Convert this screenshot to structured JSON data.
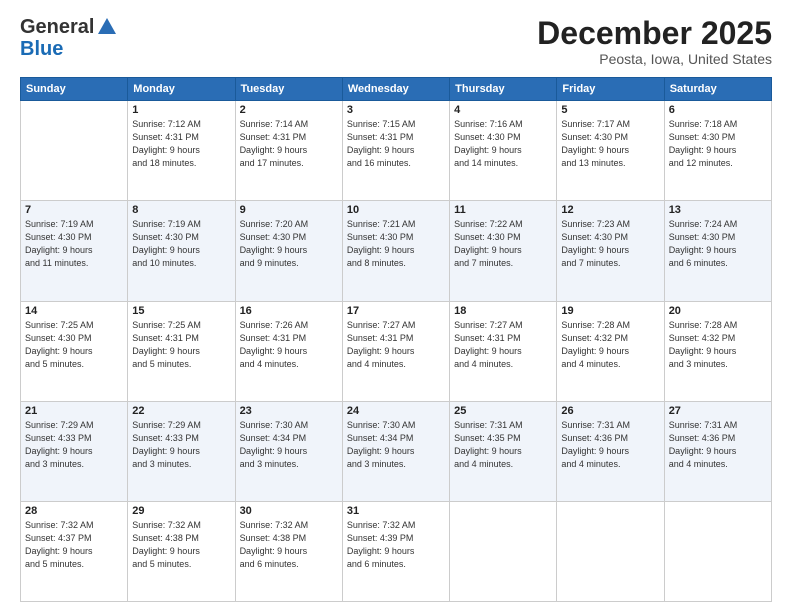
{
  "logo": {
    "general": "General",
    "blue": "Blue"
  },
  "header": {
    "month": "December 2025",
    "location": "Peosta, Iowa, United States"
  },
  "weekdays": [
    "Sunday",
    "Monday",
    "Tuesday",
    "Wednesday",
    "Thursday",
    "Friday",
    "Saturday"
  ],
  "weeks": [
    [
      {
        "day": "",
        "info": ""
      },
      {
        "day": "1",
        "info": "Sunrise: 7:12 AM\nSunset: 4:31 PM\nDaylight: 9 hours\nand 18 minutes."
      },
      {
        "day": "2",
        "info": "Sunrise: 7:14 AM\nSunset: 4:31 PM\nDaylight: 9 hours\nand 17 minutes."
      },
      {
        "day": "3",
        "info": "Sunrise: 7:15 AM\nSunset: 4:31 PM\nDaylight: 9 hours\nand 16 minutes."
      },
      {
        "day": "4",
        "info": "Sunrise: 7:16 AM\nSunset: 4:30 PM\nDaylight: 9 hours\nand 14 minutes."
      },
      {
        "day": "5",
        "info": "Sunrise: 7:17 AM\nSunset: 4:30 PM\nDaylight: 9 hours\nand 13 minutes."
      },
      {
        "day": "6",
        "info": "Sunrise: 7:18 AM\nSunset: 4:30 PM\nDaylight: 9 hours\nand 12 minutes."
      }
    ],
    [
      {
        "day": "7",
        "info": "Sunrise: 7:19 AM\nSunset: 4:30 PM\nDaylight: 9 hours\nand 11 minutes."
      },
      {
        "day": "8",
        "info": "Sunrise: 7:19 AM\nSunset: 4:30 PM\nDaylight: 9 hours\nand 10 minutes."
      },
      {
        "day": "9",
        "info": "Sunrise: 7:20 AM\nSunset: 4:30 PM\nDaylight: 9 hours\nand 9 minutes."
      },
      {
        "day": "10",
        "info": "Sunrise: 7:21 AM\nSunset: 4:30 PM\nDaylight: 9 hours\nand 8 minutes."
      },
      {
        "day": "11",
        "info": "Sunrise: 7:22 AM\nSunset: 4:30 PM\nDaylight: 9 hours\nand 7 minutes."
      },
      {
        "day": "12",
        "info": "Sunrise: 7:23 AM\nSunset: 4:30 PM\nDaylight: 9 hours\nand 7 minutes."
      },
      {
        "day": "13",
        "info": "Sunrise: 7:24 AM\nSunset: 4:30 PM\nDaylight: 9 hours\nand 6 minutes."
      }
    ],
    [
      {
        "day": "14",
        "info": "Sunrise: 7:25 AM\nSunset: 4:30 PM\nDaylight: 9 hours\nand 5 minutes."
      },
      {
        "day": "15",
        "info": "Sunrise: 7:25 AM\nSunset: 4:31 PM\nDaylight: 9 hours\nand 5 minutes."
      },
      {
        "day": "16",
        "info": "Sunrise: 7:26 AM\nSunset: 4:31 PM\nDaylight: 9 hours\nand 4 minutes."
      },
      {
        "day": "17",
        "info": "Sunrise: 7:27 AM\nSunset: 4:31 PM\nDaylight: 9 hours\nand 4 minutes."
      },
      {
        "day": "18",
        "info": "Sunrise: 7:27 AM\nSunset: 4:31 PM\nDaylight: 9 hours\nand 4 minutes."
      },
      {
        "day": "19",
        "info": "Sunrise: 7:28 AM\nSunset: 4:32 PM\nDaylight: 9 hours\nand 4 minutes."
      },
      {
        "day": "20",
        "info": "Sunrise: 7:28 AM\nSunset: 4:32 PM\nDaylight: 9 hours\nand 3 minutes."
      }
    ],
    [
      {
        "day": "21",
        "info": "Sunrise: 7:29 AM\nSunset: 4:33 PM\nDaylight: 9 hours\nand 3 minutes."
      },
      {
        "day": "22",
        "info": "Sunrise: 7:29 AM\nSunset: 4:33 PM\nDaylight: 9 hours\nand 3 minutes."
      },
      {
        "day": "23",
        "info": "Sunrise: 7:30 AM\nSunset: 4:34 PM\nDaylight: 9 hours\nand 3 minutes."
      },
      {
        "day": "24",
        "info": "Sunrise: 7:30 AM\nSunset: 4:34 PM\nDaylight: 9 hours\nand 3 minutes."
      },
      {
        "day": "25",
        "info": "Sunrise: 7:31 AM\nSunset: 4:35 PM\nDaylight: 9 hours\nand 4 minutes."
      },
      {
        "day": "26",
        "info": "Sunrise: 7:31 AM\nSunset: 4:36 PM\nDaylight: 9 hours\nand 4 minutes."
      },
      {
        "day": "27",
        "info": "Sunrise: 7:31 AM\nSunset: 4:36 PM\nDaylight: 9 hours\nand 4 minutes."
      }
    ],
    [
      {
        "day": "28",
        "info": "Sunrise: 7:32 AM\nSunset: 4:37 PM\nDaylight: 9 hours\nand 5 minutes."
      },
      {
        "day": "29",
        "info": "Sunrise: 7:32 AM\nSunset: 4:38 PM\nDaylight: 9 hours\nand 5 minutes."
      },
      {
        "day": "30",
        "info": "Sunrise: 7:32 AM\nSunset: 4:38 PM\nDaylight: 9 hours\nand 6 minutes."
      },
      {
        "day": "31",
        "info": "Sunrise: 7:32 AM\nSunset: 4:39 PM\nDaylight: 9 hours\nand 6 minutes."
      },
      {
        "day": "",
        "info": ""
      },
      {
        "day": "",
        "info": ""
      },
      {
        "day": "",
        "info": ""
      }
    ]
  ]
}
